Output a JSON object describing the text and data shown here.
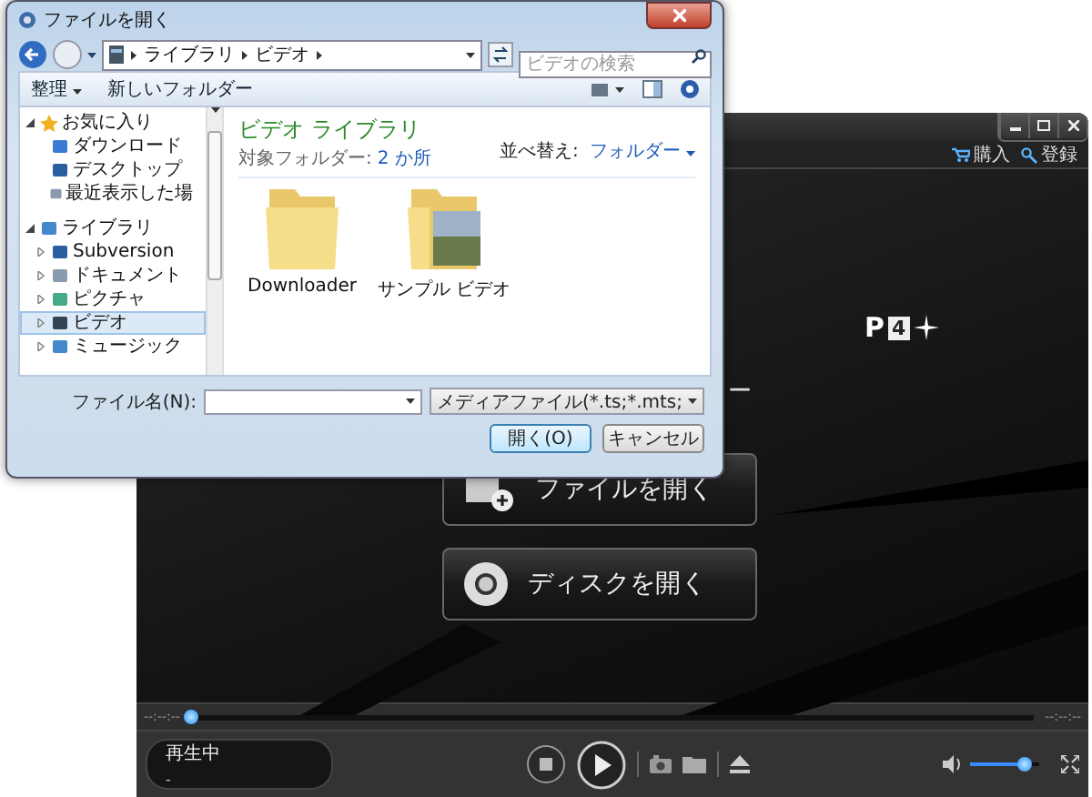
{
  "player": {
    "header_links": [
      {
        "label": "購入"
      },
      {
        "label": "登録"
      }
    ],
    "logo": {
      "text": "P",
      "badge": "4",
      "subtitle": "ー"
    },
    "actions": [
      {
        "label": "ファイルを開く",
        "kind": "file"
      },
      {
        "label": "ディスクを開く",
        "kind": "disc"
      }
    ],
    "seek": {
      "start_time": "--:--:--",
      "end_time": "--:--:--",
      "level": 0
    },
    "status": {
      "state": "再生中",
      "detail": "-"
    },
    "volume": {
      "level": 0.8
    }
  },
  "dialog": {
    "title": "ファイルを開く",
    "breadcrumb": [
      "ライブラリ",
      "ビデオ"
    ],
    "search": {
      "placeholder": "ビデオの検索"
    },
    "toolbar": [
      {
        "label": "整理",
        "dropdown": true
      },
      {
        "label": "新しいフォルダー",
        "dropdown": false
      }
    ],
    "nav_pane": {
      "items": [
        {
          "label": "お気に入り",
          "expanded": true,
          "selected": false,
          "children": [
            {
              "label": "ダウンロード",
              "selected": false
            },
            {
              "label": "デスクトップ",
              "selected": false
            },
            {
              "label": "最近表示した場",
              "selected": false
            }
          ]
        },
        {
          "label": "ライブラリ",
          "expanded": true,
          "selected": false,
          "children": [
            {
              "label": "Subversion",
              "expanded": false,
              "selected": false
            },
            {
              "label": "ドキュメント",
              "expanded": false,
              "selected": false
            },
            {
              "label": "ピクチャ",
              "expanded": false,
              "selected": false
            },
            {
              "label": "ビデオ",
              "expanded": false,
              "selected": true
            },
            {
              "label": "ミュージック",
              "expanded": false,
              "selected": false
            }
          ]
        }
      ]
    },
    "library": {
      "title": "ビデオ ライブラリ",
      "scope_label": "対象フォルダー:",
      "scope_link": "2 か所",
      "sort_label": "並べ替え:",
      "sort_value": "フォルダー"
    },
    "items": [
      {
        "label": "Downloader",
        "kind": "folder"
      },
      {
        "label": "サンプル ビデオ",
        "kind": "photo-folder"
      }
    ],
    "file_name": {
      "label": "ファイル名(N):"
    },
    "file_type": "メディアファイル(*.ts;*.mts;",
    "buttons": [
      {
        "label": "開く(O)",
        "selected": true
      },
      {
        "label": "キャンセル",
        "selected": false
      }
    ]
  }
}
